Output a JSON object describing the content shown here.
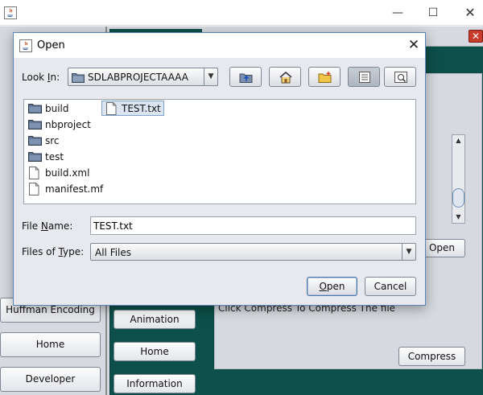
{
  "background": {
    "window_controls": {
      "minimize": "—",
      "maximize": "☐",
      "close": "✕"
    },
    "inner_close": "✕",
    "inner_open_label": "Open",
    "hint": "Click Compress To Compress The file",
    "compress_label": "Compress",
    "left_menu": [
      "Huffman Encoding",
      "Home",
      "Developer"
    ],
    "teal_menu": [
      "Animation",
      "Home",
      "Information"
    ]
  },
  "dialog": {
    "title": "Open",
    "close": "✕",
    "look_in": {
      "label_pre": "Look ",
      "label_mnemonic": "I",
      "label_post": "n:",
      "value": "SDLABPROJECTAAAA"
    },
    "files": [
      {
        "name": "build",
        "type": "folder"
      },
      {
        "name": "nbproject",
        "type": "folder"
      },
      {
        "name": "src",
        "type": "folder"
      },
      {
        "name": "test",
        "type": "folder"
      },
      {
        "name": "build.xml",
        "type": "file"
      },
      {
        "name": "manifest.mf",
        "type": "file"
      },
      {
        "name": "TEST.txt",
        "type": "file",
        "selected": true
      }
    ],
    "file_name": {
      "label_pre": "File ",
      "label_mnemonic": "N",
      "label_post": "ame:",
      "value": "TEST.txt"
    },
    "file_type": {
      "label_pre": "Files of ",
      "label_mnemonic": "T",
      "label_post": "ype:",
      "value": "All Files"
    },
    "open_button": {
      "mnemonic": "O",
      "rest": "pen"
    },
    "cancel_button": "Cancel"
  },
  "colors": {
    "teal": "#0d4f4a",
    "dialog_border": "#5b84b8",
    "close_red": "#c93b2b",
    "folder": "#5a6f8c"
  }
}
